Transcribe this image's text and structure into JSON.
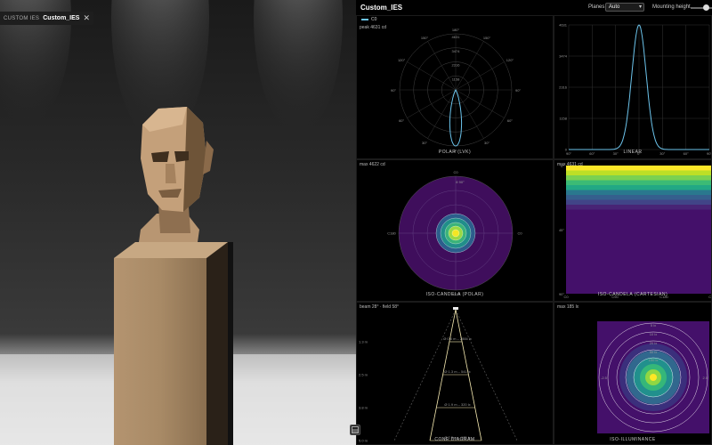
{
  "viewport": {
    "tab_label": "CUSTOM IES",
    "tab_file": "Custom_IES",
    "close_glyph": "✕",
    "toggle_icon": "panel-toggle-icon"
  },
  "header": {
    "title": "Custom_IES",
    "planes_label": "Planes",
    "planes_value": "Auto",
    "mounting_label": "Mounting height",
    "mounting_level": 0.65
  },
  "legend": {
    "series_name": "C0",
    "color": "#6cc4ec"
  },
  "polar": {
    "peak_label": "peak 4631 cd",
    "caption": "POLAR (LVK)",
    "angle_labels": [
      "180°",
      "150°",
      "150°",
      "120°",
      "120°",
      "90°",
      "90°",
      "60°",
      "60°",
      "30°",
      "30°",
      "0°"
    ],
    "ring_labels": [
      "4631",
      "3474",
      "2316",
      "1158"
    ]
  },
  "linear": {
    "caption": "LINEAR",
    "y_ticks": [
      "4631",
      "3474",
      "2316",
      "1158",
      "0"
    ],
    "x_ticks": [
      "90°",
      "60°",
      "30°",
      "0°",
      "30°",
      "60°",
      "90°"
    ]
  },
  "iso_polar": {
    "max_label": "max 4622 cd",
    "caption": "ISO-CANDELA (POLAR)",
    "labels": [
      "C0",
      "C90",
      "C180",
      "C270"
    ],
    "inner_label": "θ 90°"
  },
  "iso_cart": {
    "max_label": "max 4631 cd",
    "caption": "ISO-CANDELA (CARTESIAN)",
    "y_ticks": [
      "0°",
      "45°",
      "90°"
    ],
    "x_ticks": [
      "C0",
      "C90",
      "C180",
      "C270"
    ]
  },
  "cone": {
    "beam_label": "beam 28° · field 58°",
    "caption": "CONE DIAGRAM",
    "distances": [
      "1.3 m",
      "2.5 m",
      "3.8 m",
      "5.0 m"
    ],
    "rows": [
      "Ø 0.6 m – 2884 lx",
      "Ø 1.3 m – 541 lx",
      "Ø 1.9 m – 320 lx",
      "Ø 2.5 m – 185 lx"
    ]
  },
  "iso_lux": {
    "max_label": "max 185 lx",
    "caption": "ISO-ILLUMINANCE",
    "ring_labels": [
      "5 lx",
      "10 lx",
      "20 lx",
      "50 lx",
      "100 lx"
    ],
    "side_labels": [
      "-2.5",
      "2.5"
    ]
  },
  "chart_data": [
    {
      "type": "line",
      "title": "POLAR (LVK)",
      "series": [
        {
          "name": "C0",
          "peak_cd": 4631,
          "beam_deg": 28
        }
      ],
      "ylim": [
        0,
        4631
      ]
    },
    {
      "type": "line",
      "title": "LINEAR",
      "x": [
        -90,
        -60,
        -45,
        -30,
        -20,
        -14,
        -8,
        0,
        8,
        14,
        20,
        30,
        45,
        60,
        90
      ],
      "series": [
        {
          "name": "C0",
          "values": [
            0,
            0,
            20,
            120,
            500,
            1300,
            3000,
            4631,
            3000,
            1300,
            500,
            120,
            20,
            0,
            0
          ]
        }
      ],
      "ylim": [
        0,
        4631
      ]
    }
  ]
}
